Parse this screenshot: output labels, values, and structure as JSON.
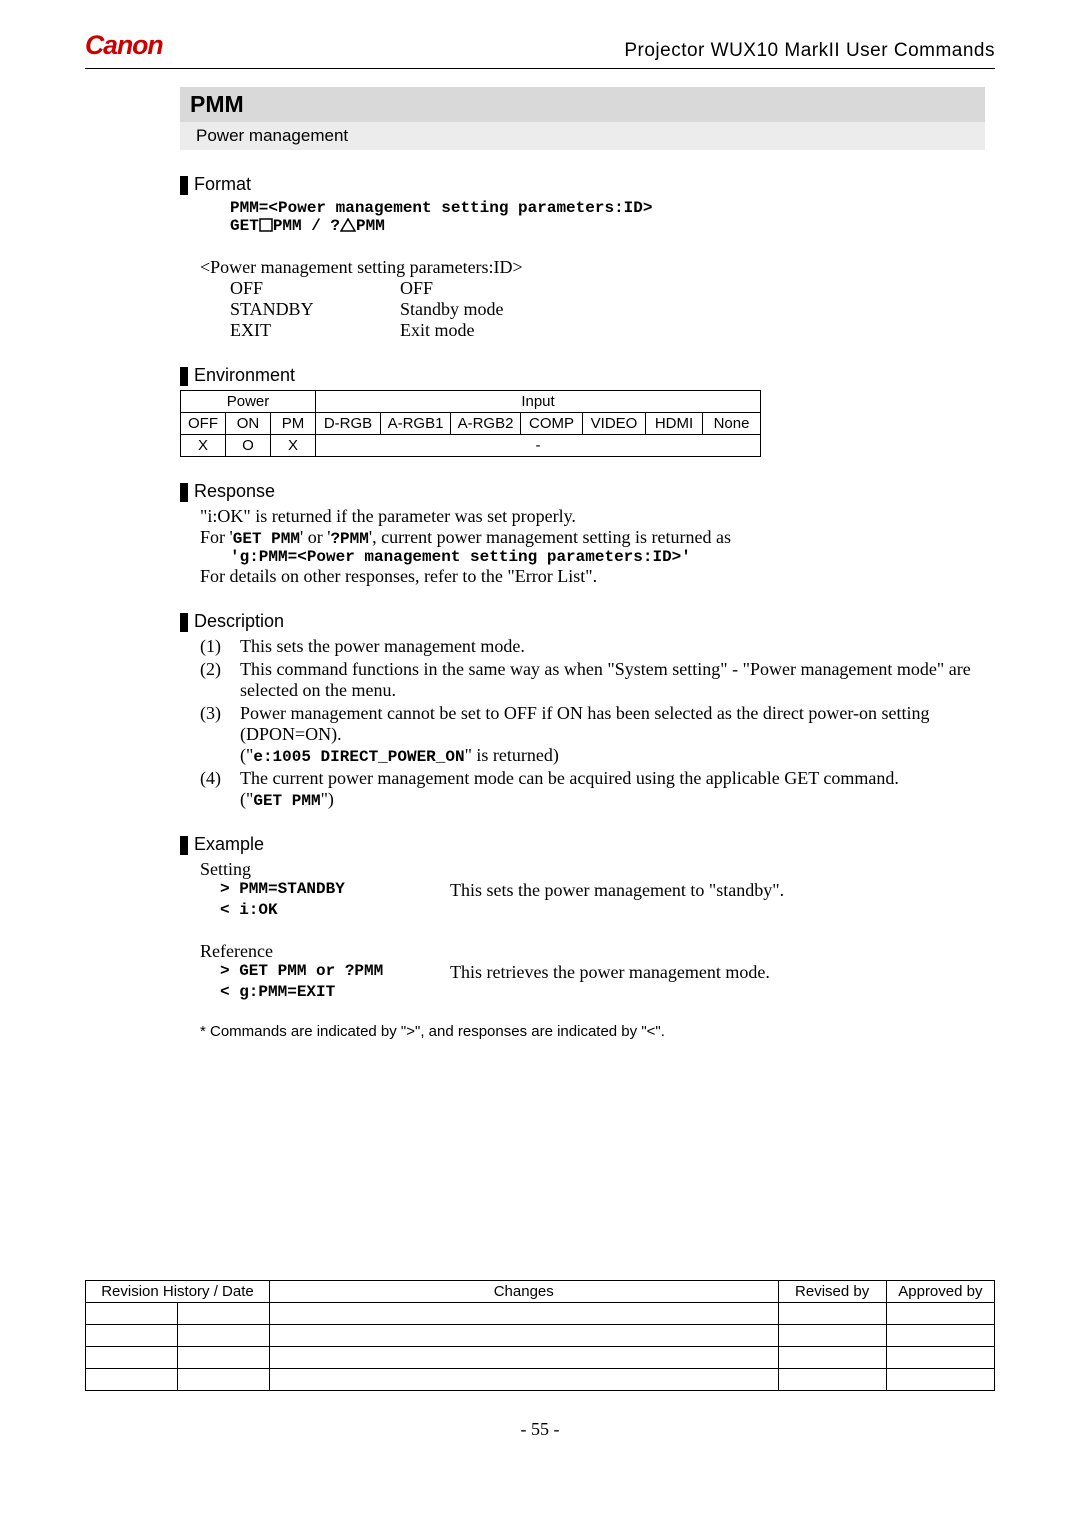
{
  "header": {
    "brand": "Canon",
    "doc_title": "Projector WUX10 MarkII User Commands"
  },
  "command": {
    "name": "PMM",
    "caption": "Power management"
  },
  "format": {
    "heading": "Format",
    "line1": "PMM=<Power management setting parameters:ID>",
    "line2_a": "GET",
    "line2_b": "PMM    /    ?",
    "line2_c": "PMM",
    "param_title": "<Power management setting parameters:ID>",
    "params": [
      {
        "id": "OFF",
        "meaning": "OFF"
      },
      {
        "id": "STANDBY",
        "meaning": "Standby mode"
      },
      {
        "id": "EXIT",
        "meaning": "Exit mode"
      }
    ]
  },
  "environment": {
    "heading": "Environment",
    "group_power": "Power",
    "group_input": "Input",
    "cols": [
      "OFF",
      "ON",
      "PM",
      "D-RGB",
      "A-RGB1",
      "A-RGB2",
      "COMP",
      "VIDEO",
      "HDMI",
      "None"
    ],
    "row": [
      "X",
      "O",
      "X",
      "-"
    ]
  },
  "response": {
    "heading": "Response",
    "line1": "\"i:OK\" is returned if the parameter was set properly.",
    "line2_a": "For '",
    "line2_b": "GET PMM",
    "line2_c": "' or '",
    "line2_d": "?PMM",
    "line2_e": "', current power management setting is returned as",
    "code": "'g:PMM=<Power management setting parameters:ID>'",
    "line3": "For details on other responses, refer to the \"Error List\"."
  },
  "description": {
    "heading": "Description",
    "items": [
      {
        "n": "(1)",
        "t": "This sets the power management mode."
      },
      {
        "n": "(2)",
        "t": "This command functions in the same way as when \"System setting\" - \"Power management mode\" are selected on the menu."
      },
      {
        "n": "(3)",
        "t": "Power management cannot be set to OFF if ON has been selected as the direct power-on setting (DPON=ON).",
        "sub_a": "(\"",
        "sub_code": "e:1005 DIRECT_POWER_ON",
        "sub_b": "\" is returned)"
      },
      {
        "n": "(4)",
        "t": "The current power management mode can be acquired using the applicable GET command.",
        "sub_a": "(\"",
        "sub_code": "GET PMM",
        "sub_b": "\")"
      }
    ]
  },
  "example": {
    "heading": "Example",
    "setting_label": "Setting",
    "setting_cmd1": "> PMM=STANDBY",
    "setting_desc": "This sets the power management to \"standby\".",
    "setting_cmd2": "< i:OK",
    "reference_label": "Reference",
    "ref_cmd1": "> GET PMM or ?PMM",
    "ref_desc": "This retrieves the power management mode.",
    "ref_cmd2": "< g:PMM=EXIT",
    "note": "* Commands are indicated by \">\", and responses are indicated by \"<\"."
  },
  "rev_table": {
    "h1": "Revision History / Date",
    "h2": "Changes",
    "h3": "Revised by",
    "h4": "Approved by"
  },
  "page_number": "- 55 -"
}
